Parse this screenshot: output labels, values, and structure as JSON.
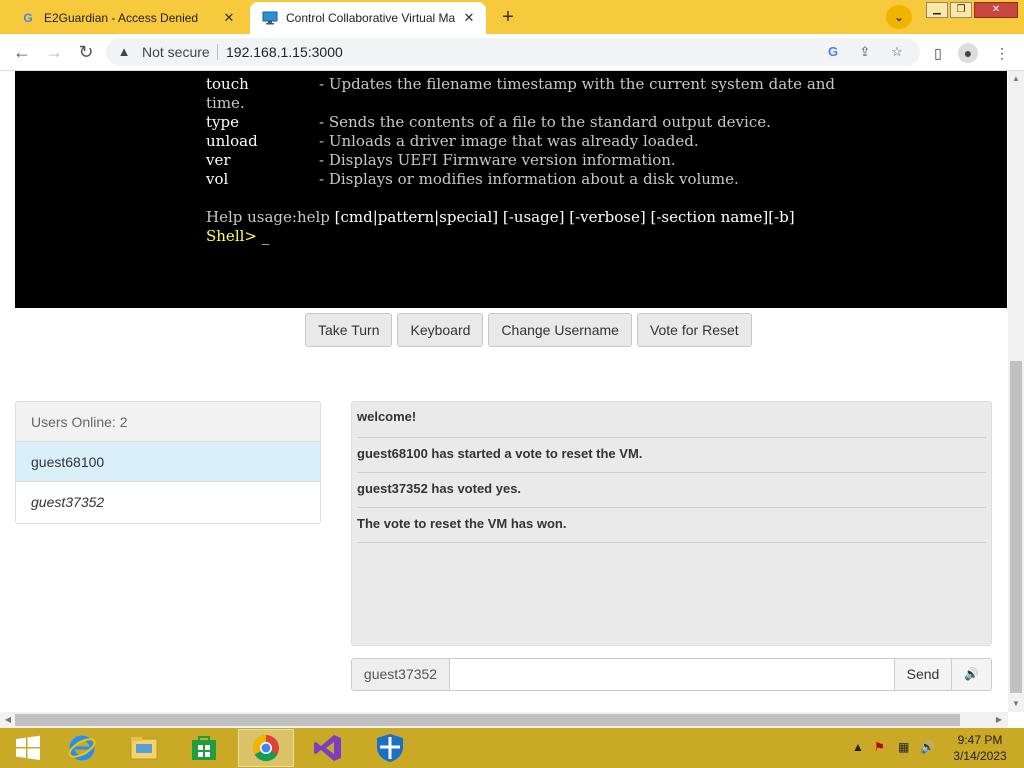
{
  "browser": {
    "tabs": [
      {
        "title": "E2Guardian - Access Denied",
        "favicon": "google-g-icon"
      },
      {
        "title": "Control Collaborative Virtual Ma",
        "favicon": "monitor-icon"
      }
    ],
    "address": {
      "security_label": "Not secure",
      "url": "192.168.1.15:3000"
    }
  },
  "terminal": {
    "lines": [
      {
        "cmd": "touch",
        "desc": "- Updates the filename timestamp with the current system date and"
      },
      {
        "cmd": "",
        "desc": "time."
      },
      {
        "cmd": "type",
        "desc": "- Sends the contents of a file to the standard output device."
      },
      {
        "cmd": "unload",
        "desc": "- Unloads a driver image that was already loaded."
      },
      {
        "cmd": "ver",
        "desc": "- Displays UEFI Firmware version information."
      },
      {
        "cmd": "vol",
        "desc": "- Displays or modifies information about a disk volume."
      }
    ],
    "help_prefix": "Help usage:help ",
    "help_args": "[cmd|pattern|special] [-usage] [-verbose] [-section name][-b]",
    "prompt": "Shell> ",
    "cursor": "_"
  },
  "vm_buttons": {
    "take_turn": "Take Turn",
    "keyboard": "Keyboard",
    "change_username": "Change Username",
    "vote_reset": "Vote for Reset"
  },
  "users": {
    "header": "Users Online: 2",
    "list": [
      "guest68100",
      "guest37352"
    ]
  },
  "chat": {
    "messages": [
      "welcome!",
      "guest68100 has started a vote to reset the VM.",
      "guest37352 has voted yes.",
      "The vote to reset the VM has won."
    ],
    "username": "guest37352",
    "input_value": "",
    "send_label": "Send"
  },
  "taskbar": {
    "apps": [
      "windows-start-icon",
      "internet-explorer-icon",
      "file-explorer-icon",
      "windows-store-icon",
      "chrome-icon",
      "visual-studio-icon",
      "windows-defender-icon"
    ],
    "time": "9:47 PM",
    "date": "3/14/2023"
  }
}
